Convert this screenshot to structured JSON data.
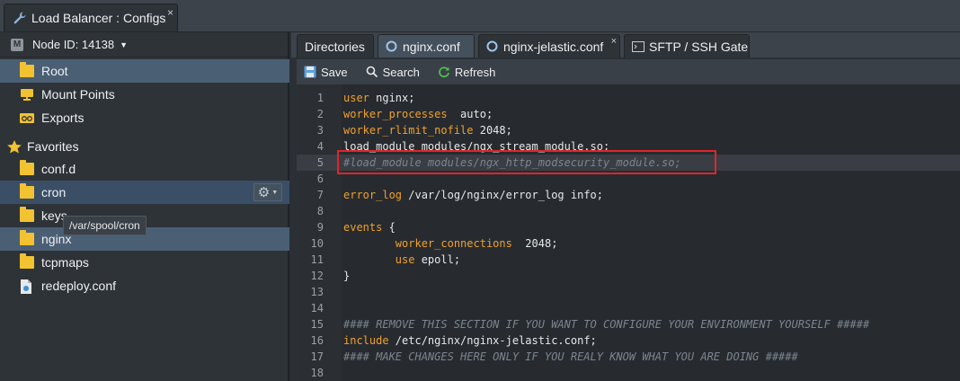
{
  "window": {
    "tab_title": "Load Balancer : Configs",
    "close": "×"
  },
  "left": {
    "node_label": "Node ID: 14138",
    "node_icon": "M",
    "items": [
      {
        "label": "Root",
        "icon": "folder-icon"
      },
      {
        "label": "Mount Points",
        "icon": "mount-icon"
      },
      {
        "label": "Exports",
        "icon": "exports-icon"
      },
      {
        "label": "Favorites",
        "icon": "star-icon"
      },
      {
        "label": "conf.d",
        "icon": "folder-icon"
      },
      {
        "label": "cron",
        "icon": "folder-icon"
      },
      {
        "label": "keys",
        "icon": "folder-icon"
      },
      {
        "label": "nginx",
        "icon": "folder-icon"
      },
      {
        "label": "tcpmaps",
        "icon": "folder-icon"
      },
      {
        "label": "redeploy.conf",
        "icon": "file-icon"
      }
    ],
    "tooltip": "/var/spool/cron"
  },
  "tabs": [
    {
      "label": "Directories"
    },
    {
      "label": "nginx.conf"
    },
    {
      "label": "nginx-jelastic.conf"
    },
    {
      "label": "SFTP / SSH Gate"
    }
  ],
  "toolbar": {
    "save": "Save",
    "search": "Search",
    "refresh": "Refresh"
  },
  "code": {
    "line_numbers": [
      "1",
      "2",
      "3",
      "4",
      "5",
      "6",
      "7",
      "8",
      "9",
      "10",
      "11",
      "12",
      "13",
      "14",
      "15",
      "16",
      "17",
      "18"
    ],
    "l1": {
      "kw": "user",
      "rest": " nginx;"
    },
    "l2": {
      "kw": "worker_processes",
      "rest": "  auto;"
    },
    "l3": {
      "kw": "worker_rlimit_nofile",
      "rest": " 2048;"
    },
    "l4": {
      "text": "load_module modules/ngx_stream_module.so;"
    },
    "l5": {
      "comment": "#load_module modules/ngx_http_modsecurity_module.so;"
    },
    "l7": {
      "kw": "error_log",
      "rest": " /var/log/nginx/error_log info;"
    },
    "l9": {
      "kw": "events",
      "rest": " {"
    },
    "l10": {
      "indent": "        ",
      "kw": "worker_connections",
      "rest": "  2048;"
    },
    "l11": {
      "indent": "        ",
      "kw": "use",
      "rest": " epoll;"
    },
    "l12": {
      "text": "}"
    },
    "l15": {
      "comment": "#### REMOVE THIS SECTION IF YOU WANT TO CONFIGURE YOUR ENVIRONMENT YOURSELF #####"
    },
    "l16": {
      "kw": "include",
      "rest": " /etc/nginx/nginx-jelastic.conf;"
    },
    "l17": {
      "comment": "#### MAKE CHANGES HERE ONLY IF YOU REALY KNOW WHAT YOU ARE DOING #####"
    }
  },
  "colors": {
    "keyword": "#f0a030",
    "comment": "#7c8590",
    "highlight_box": "#e0252b",
    "folder": "#f2c230",
    "selected": "#4a5f74"
  }
}
